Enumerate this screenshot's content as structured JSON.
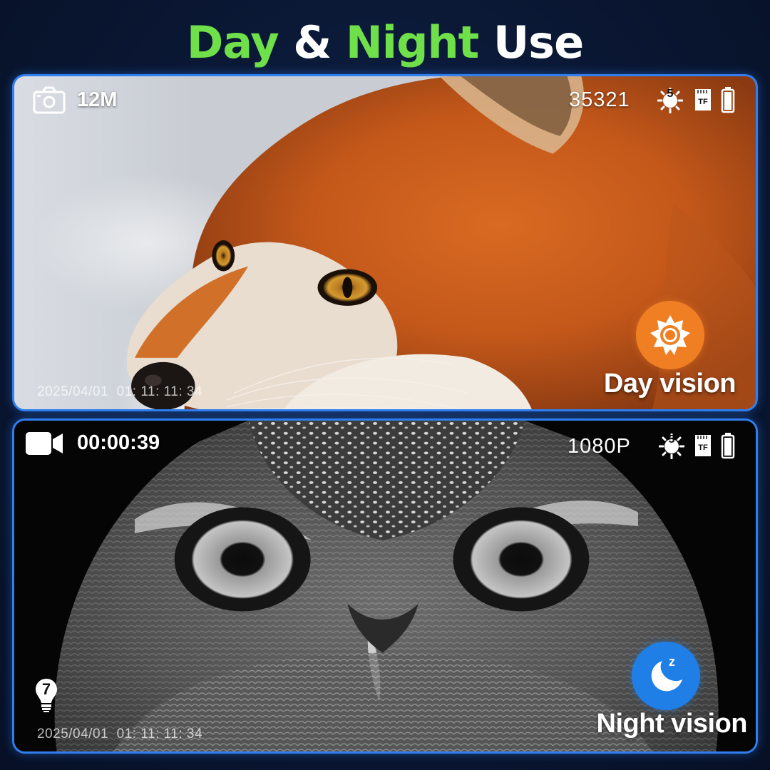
{
  "headline": {
    "part1": "Day",
    "amp": " & ",
    "part2": "Night",
    "part3": " Use"
  },
  "colors": {
    "accent_green": "#6fe04a",
    "frame_blue": "#2f7ff0",
    "sun_orange": "#f07f24",
    "moon_blue": "#1f7fe6"
  },
  "day_panel": {
    "mode_icon": "camera-icon",
    "resolution": "12M",
    "counter": "35321",
    "sensitivity_level": "5",
    "sensitivity_icon": "sun-gear-icon",
    "storage_icon": "tf-card-icon",
    "storage_label": "TF",
    "battery_icon": "battery-icon",
    "timestamp": "2025/04/01  01: 11: 11: 34",
    "badge_icon": "sun-icon",
    "mode_label": "Day vision"
  },
  "night_panel": {
    "mode_icon": "video-camera-icon",
    "elapsed": "00:00:39",
    "resolution": "1080P",
    "sensitivity_level": "5",
    "sensitivity_icon": "sun-gear-icon",
    "storage_icon": "tf-card-icon",
    "storage_label": "TF",
    "battery_icon": "battery-icon",
    "ir_level": "7",
    "ir_icon": "bulb-icon",
    "timestamp": "2025/04/01  01: 11: 11: 34",
    "badge_icon": "moon-icon",
    "badge_glyph": "z",
    "mode_label": "Night vision"
  }
}
